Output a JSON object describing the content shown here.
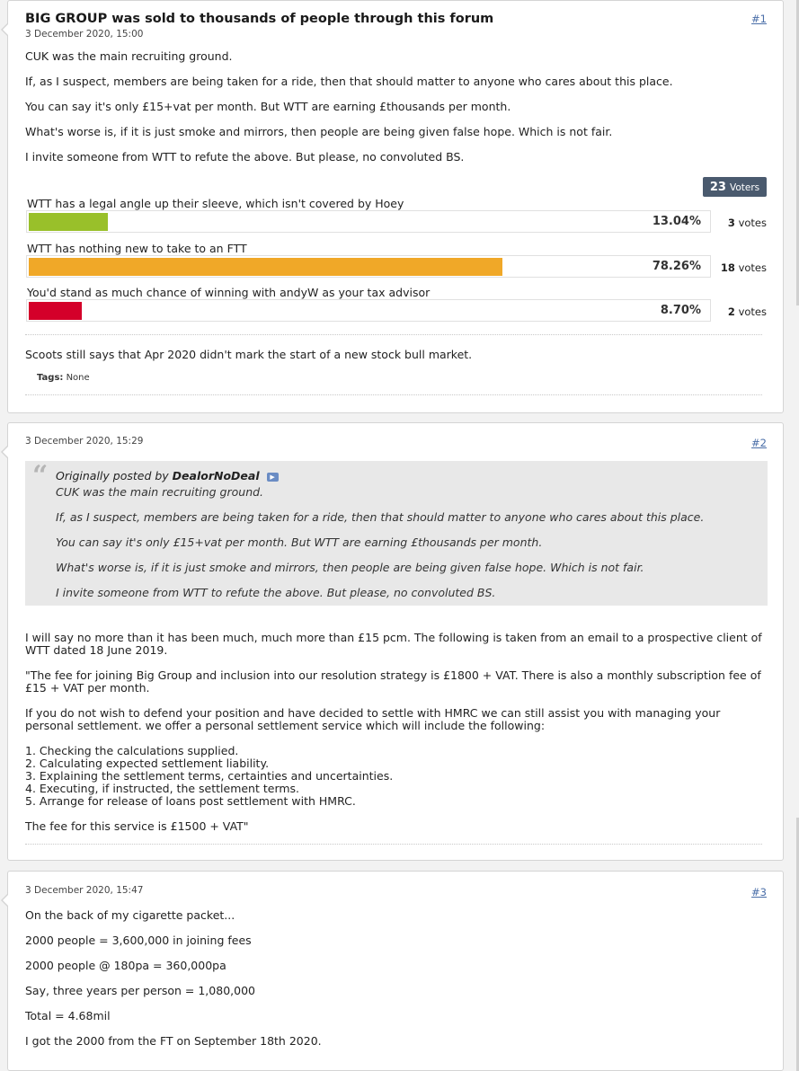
{
  "post1": {
    "title": "BIG GROUP was sold to thousands of people through this forum",
    "date": "3 December 2020, 15:00",
    "number": "#1",
    "paragraphs": [
      "CUK was the main recruiting ground.",
      "If, as I suspect, members are being taken for a ride, then that should matter to anyone who cares about this place.",
      "You can say it's only £15+vat per month. But WTT are earning £thousands per month.",
      "What's worse is, if it is just smoke and mirrors, then people are being given false hope. Which is not fair.",
      "I invite someone from WTT to refute the above. But please, no convoluted BS."
    ],
    "poll": {
      "voters_count": "23",
      "voters_label": "Voters",
      "options": [
        {
          "question": "WTT has a legal angle up their sleeve, which isn't covered by Hoey",
          "percent": "13.04%",
          "fraction": 0.1304,
          "votes_num": "3",
          "votes_label": "votes",
          "color": "#99c02a"
        },
        {
          "question": "WTT has nothing new to take to an FTT",
          "percent": "78.26%",
          "fraction": 0.7826,
          "votes_num": "18",
          "votes_label": "votes",
          "color": "#f0a828"
        },
        {
          "question": "You'd stand as much chance of winning with andyW as your tax advisor",
          "percent": "8.70%",
          "fraction": 0.087,
          "votes_num": "2",
          "votes_label": "votes",
          "color": "#d4002a"
        }
      ]
    },
    "signature": "Scoots still says that Apr 2020 didn't mark the start of a new stock bull market.",
    "tags_label": "Tags:",
    "tags_value": "None"
  },
  "post2": {
    "date": "3 December 2020, 15:29",
    "number": "#2",
    "quote": {
      "prefix": "Originally posted by",
      "author": "DealorNoDeal",
      "lines": [
        "CUK was the main recruiting ground.",
        "If, as I suspect, members are being taken for a ride, then that should matter to anyone who cares about this place.",
        "You can say it's only £15+vat per month. But WTT are earning £thousands per month.",
        "What's worse is, if it is just smoke and mirrors, then people are being given false hope. Which is not fair.",
        "I invite someone from WTT to refute the above. But please, no convoluted BS."
      ]
    },
    "p1": "I will say no more than it has been much, much more than £15 pcm. The following is taken from an email to a prospective client of WTT dated 18 June 2019.",
    "p2": "\"The fee for joining Big Group and inclusion into our resolution strategy is £1800 + VAT. There is also a monthly subscription fee of £15 + VAT per month.",
    "p3": "If you do not wish to defend your position and have decided to settle with HMRC we can still assist you with managing your personal settlement. we offer a personal settlement service which will include the following:",
    "list": [
      "1. Checking the calculations supplied.",
      "2. Calculating expected settlement liability.",
      "3. Explaining the settlement terms, certainties and uncertainties.",
      "4. Executing, if instructed, the settlement terms.",
      "5. Arrange for release of loans post settlement with HMRC."
    ],
    "p4": "The fee for this service is £1500 + VAT\""
  },
  "post3": {
    "date": "3 December 2020, 15:47",
    "number": "#3",
    "lines": [
      "On the back of my cigarette packet...",
      "2000 people = 3,600,000 in joining fees",
      "2000 people @ 180pa = 360,000pa",
      "Say, three years per person = 1,080,000",
      "Total = 4.68mil",
      "I got the 2000 from the FT on September 18th 2020."
    ]
  }
}
